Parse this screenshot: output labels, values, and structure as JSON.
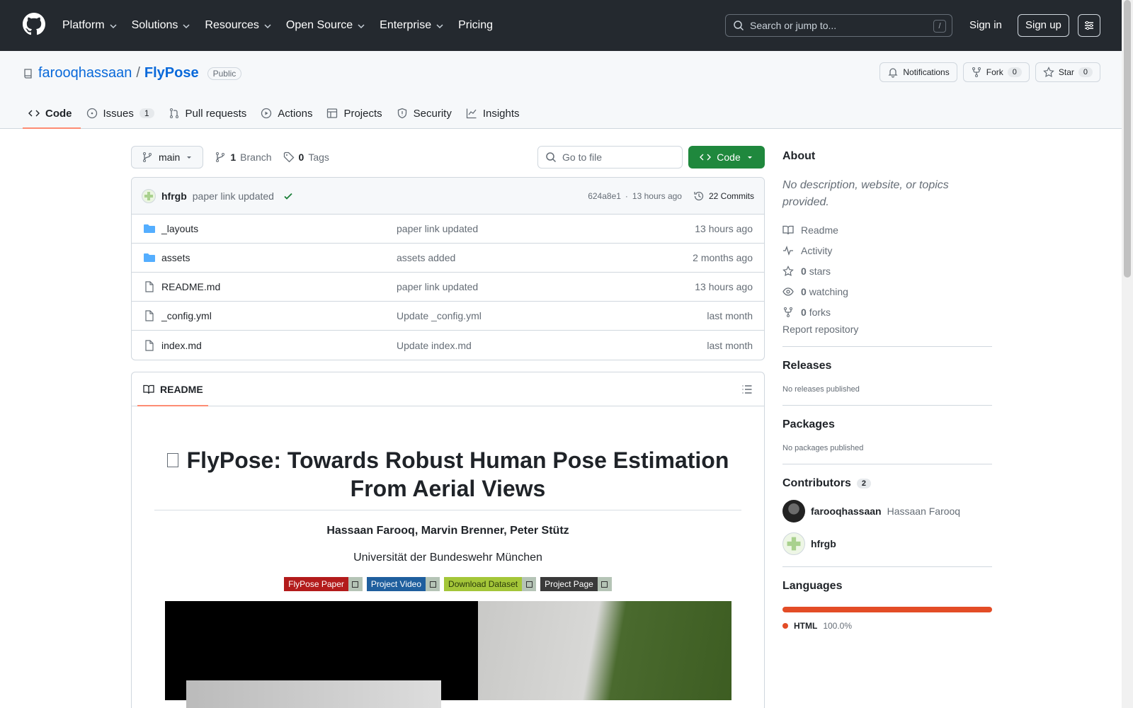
{
  "header": {
    "nav": [
      "Platform",
      "Solutions",
      "Resources",
      "Open Source",
      "Enterprise",
      "Pricing"
    ],
    "search_placeholder": "Search or jump to...",
    "search_shortcut": "/",
    "sign_in": "Sign in",
    "sign_up": "Sign up"
  },
  "repo": {
    "owner": "farooqhassaan",
    "separator": "/",
    "name": "FlyPose",
    "visibility": "Public",
    "notifications": "Notifications",
    "fork_label": "Fork",
    "fork_count": "0",
    "star_label": "Star",
    "star_count": "0"
  },
  "tabs": [
    {
      "label": "Code",
      "count": ""
    },
    {
      "label": "Issues",
      "count": "1"
    },
    {
      "label": "Pull requests",
      "count": ""
    },
    {
      "label": "Actions",
      "count": ""
    },
    {
      "label": "Projects",
      "count": ""
    },
    {
      "label": "Security",
      "count": ""
    },
    {
      "label": "Insights",
      "count": ""
    }
  ],
  "toolbar": {
    "branch": "main",
    "branch_count": "1",
    "branch_label": "Branch",
    "tag_count": "0",
    "tag_label": "Tags",
    "goto_placeholder": "Go to file",
    "code_label": "Code"
  },
  "commit": {
    "author": "hfrgb",
    "message": "paper link updated",
    "sha": "624a8e1",
    "sep": "·",
    "time": "13 hours ago",
    "commits": "22 Commits"
  },
  "files": [
    {
      "name": "_layouts",
      "type": "dir",
      "message": "paper link updated",
      "time": "13 hours ago"
    },
    {
      "name": "assets",
      "type": "dir",
      "message": "assets added",
      "time": "2 months ago"
    },
    {
      "name": "README.md",
      "type": "file",
      "message": "paper link updated",
      "time": "13 hours ago"
    },
    {
      "name": "_config.yml",
      "type": "file",
      "message": "Update _config.yml",
      "time": "last month"
    },
    {
      "name": "index.md",
      "type": "file",
      "message": "Update index.md",
      "time": "last month"
    }
  ],
  "readme": {
    "tab": "README",
    "title": "FlyPose: Towards Robust Human Pose Estimation From Aerial Views",
    "authors": "Hassaan Farooq, Marvin Brenner, Peter Stütz",
    "affiliation": "Universität der Bundeswehr München",
    "badges": [
      {
        "label": "FlyPose Paper",
        "color": "#b31b1b"
      },
      {
        "label": "Project Video",
        "color": "#1f5f9e"
      },
      {
        "label": "Download Dataset",
        "color": "#a4c639"
      },
      {
        "label": "Project Page",
        "color": "#3a3a3a"
      }
    ]
  },
  "about": {
    "title": "About",
    "description": "No description, website, or topics provided.",
    "readme": "Readme",
    "activity": "Activity",
    "stars_count": "0",
    "stars_label": "stars",
    "watching_count": "0",
    "watching_label": "watching",
    "forks_count": "0",
    "forks_label": "forks",
    "report": "Report repository"
  },
  "releases": {
    "title": "Releases",
    "empty": "No releases published"
  },
  "packages": {
    "title": "Packages",
    "empty": "No packages published"
  },
  "contributors": {
    "title": "Contributors",
    "count": "2",
    "list": [
      {
        "login": "farooqhassaan",
        "name": "Hassaan Farooq"
      },
      {
        "login": "hfrgb",
        "name": ""
      }
    ]
  },
  "languages": {
    "title": "Languages",
    "list": [
      {
        "name": "HTML",
        "percent": "100.0%",
        "color": "#e34c26"
      }
    ]
  },
  "colors": {
    "accent": "#0969da",
    "header_bg": "#24292f",
    "primary_button": "#1f883d",
    "tab_underline": "#fd8c73"
  }
}
